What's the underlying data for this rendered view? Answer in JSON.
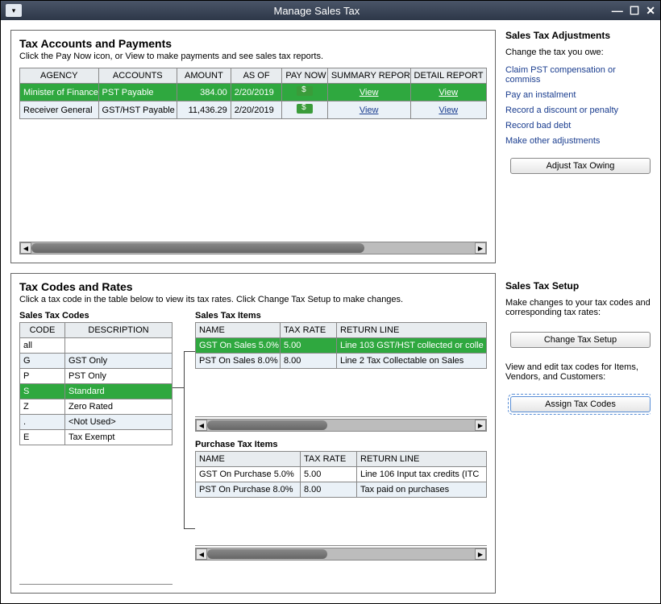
{
  "window": {
    "title": "Manage Sales Tax"
  },
  "accounts_panel": {
    "heading": "Tax Accounts and Payments",
    "sub": "Click the Pay Now icon, or View to make payments and see sales tax reports.",
    "columns": {
      "agency": "AGENCY",
      "accounts": "ACCOUNTS",
      "amount": "AMOUNT",
      "asof": "AS OF",
      "paynow": "PAY NOW",
      "summary": "SUMMARY REPORT",
      "detail": "DETAIL REPORT"
    },
    "rows": [
      {
        "agency": "Minister of Finance",
        "accounts": "PST Payable",
        "amount": "384.00",
        "asof": "2/20/2019",
        "summary": "View",
        "detail": "View",
        "selected": true
      },
      {
        "agency": "Receiver General",
        "accounts": "GST/HST Payable",
        "amount": "11,436.29",
        "asof": "2/20/2019",
        "summary": "View",
        "detail": "View",
        "selected": false
      }
    ]
  },
  "codes_panel": {
    "heading": "Tax Codes and Rates",
    "sub": "Click a tax code in the table below to view its tax rates. Click Change Tax Setup to make changes.",
    "codes_heading": "Sales Tax Codes",
    "codes_columns": {
      "code": "CODE",
      "desc": "DESCRIPTION"
    },
    "codes": [
      {
        "code": "all",
        "desc": "",
        "selected": false
      },
      {
        "code": "G",
        "desc": "GST Only",
        "selected": false
      },
      {
        "code": "P",
        "desc": "PST Only",
        "selected": false
      },
      {
        "code": "S",
        "desc": "Standard",
        "selected": true
      },
      {
        "code": "Z",
        "desc": "Zero Rated",
        "selected": false
      },
      {
        "code": ".",
        "desc": "<Not Used>",
        "selected": false
      },
      {
        "code": "E",
        "desc": "Tax Exempt",
        "selected": false
      }
    ],
    "sales_items_heading": "Sales Tax Items",
    "items_columns": {
      "name": "NAME",
      "rate": "TAX RATE",
      "return": "RETURN LINE"
    },
    "sales_items": [
      {
        "name": "GST On Sales 5.0%",
        "rate": "5.00",
        "return": "Line 103 GST/HST collected or colle",
        "selected": true
      },
      {
        "name": "PST On Sales 8.0%",
        "rate": "8.00",
        "return": "Line 2 Tax Collectable on Sales",
        "selected": false
      }
    ],
    "purchase_items_heading": "Purchase Tax Items",
    "purchase_items": [
      {
        "name": "GST On Purchase 5.0%",
        "rate": "5.00",
        "return": "Line 106 Input tax credits (ITC",
        "selected": false
      },
      {
        "name": "PST On Purchase 8.0%",
        "rate": "8.00",
        "return": "Tax paid on purchases",
        "selected": false
      }
    ]
  },
  "adjustments": {
    "heading": "Sales Tax Adjustments",
    "sub": "Change the tax you owe:",
    "links": [
      "Claim PST compensation or commiss",
      "Pay an instalment",
      "Record a discount or penalty",
      "Record bad debt",
      "Make other adjustments"
    ],
    "button": "Adjust Tax Owing"
  },
  "setup": {
    "heading": "Sales Tax Setup",
    "sub1": "Make changes to your tax codes and corresponding tax rates:",
    "button1": "Change Tax Setup",
    "sub2": "View and edit tax codes for Items, Vendors, and Customers:",
    "button2": "Assign Tax Codes"
  }
}
